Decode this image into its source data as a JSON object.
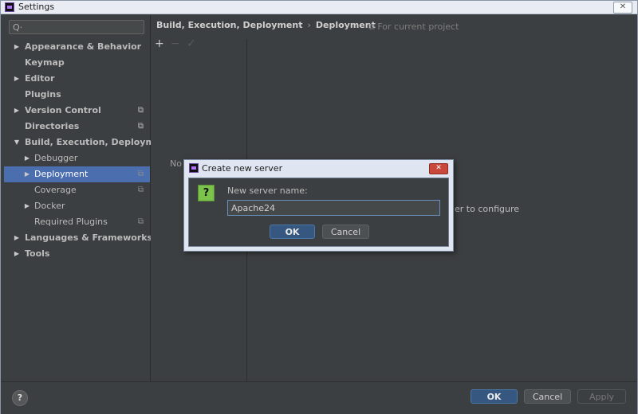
{
  "window": {
    "title": "Settings",
    "close_glyph": "✕"
  },
  "sidebar": {
    "search_icon": "Q·",
    "items": [
      {
        "label": "Appearance & Behavior",
        "arrow": "▶",
        "bold": true
      },
      {
        "label": "Keymap",
        "bold": true
      },
      {
        "label": "Editor",
        "arrow": "▶",
        "bold": true
      },
      {
        "label": "Plugins",
        "bold": true
      },
      {
        "label": "Version Control",
        "arrow": "▶",
        "bold": true,
        "copy": true
      },
      {
        "label": "Directories",
        "bold": true,
        "copy": true
      },
      {
        "label": "Build, Execution, Deployment",
        "arrow": "▼",
        "bold": true
      },
      {
        "label": "Debugger",
        "arrow": "▶"
      },
      {
        "label": "Deployment",
        "arrow": "▶",
        "selected": true,
        "copy": true
      },
      {
        "label": "Coverage",
        "copy": true
      },
      {
        "label": "Docker",
        "arrow": "▶"
      },
      {
        "label": "Required Plugins",
        "copy": true
      },
      {
        "label": "Languages & Frameworks",
        "arrow": "▶",
        "bold": true
      },
      {
        "label": "Tools",
        "arrow": "▶",
        "bold": true
      }
    ]
  },
  "main": {
    "breadcrumb": [
      "Build, Execution, Deployment",
      "Deployment"
    ],
    "breadcrumb_sep": "›",
    "for_current_project": "⧉ For current project",
    "toolbar": {
      "add": "+",
      "remove": "−",
      "apply": "✓"
    },
    "nothing_text": "No",
    "configure_text": "er to configure"
  },
  "dialog": {
    "title": "Create new server",
    "close_glyph": "✕",
    "question_glyph": "?",
    "label": "New server name:",
    "input_value": "Apache24",
    "ok": "OK",
    "cancel": "Cancel"
  },
  "footer": {
    "help": "?",
    "ok": "OK",
    "cancel": "Cancel",
    "apply": "Apply"
  }
}
